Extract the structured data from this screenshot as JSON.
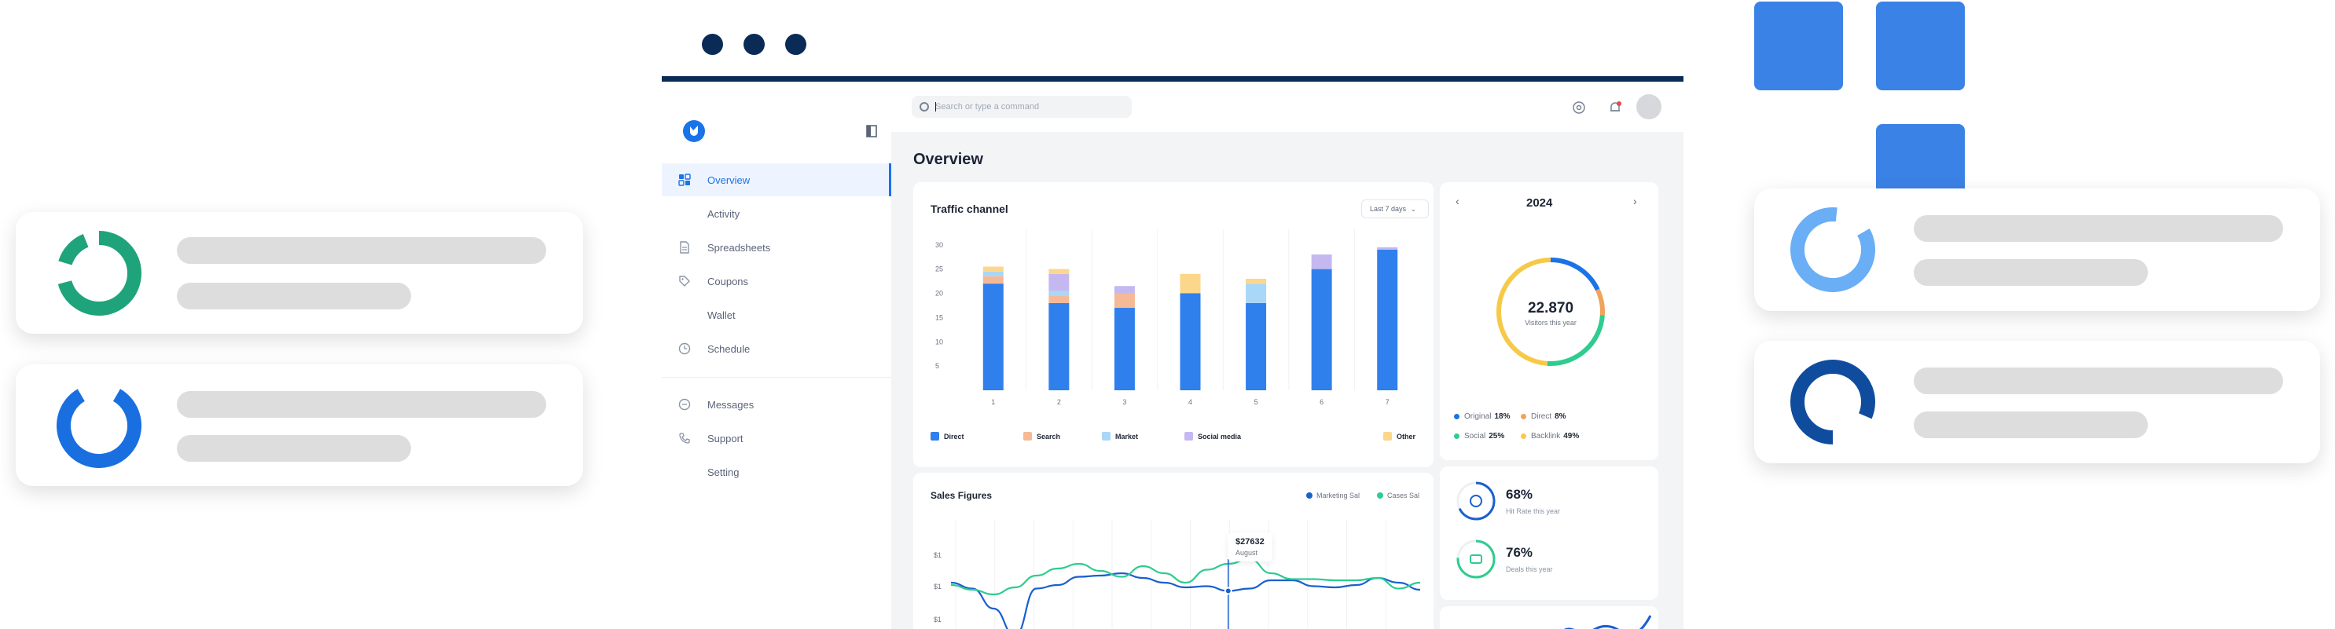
{
  "app": {
    "brand_color": "#1a73e8",
    "dark_navy": "#0b2b57"
  },
  "sidebar": {
    "items": [
      {
        "label": "Overview",
        "icon": "grid-icon",
        "active": true
      },
      {
        "label": "Activity",
        "icon": ""
      },
      {
        "label": "Spreadsheets",
        "icon": "document-icon"
      },
      {
        "label": "Coupons",
        "icon": "tag-icon"
      },
      {
        "label": "Wallet",
        "icon": ""
      },
      {
        "label": "Schedule",
        "icon": "clock-icon"
      },
      {
        "label": "Messages",
        "icon": "chat-icon"
      },
      {
        "label": "Support",
        "icon": "phone-icon"
      },
      {
        "label": "Setting",
        "icon": ""
      }
    ]
  },
  "header": {
    "search_placeholder": "Search or type a command"
  },
  "main": {
    "page_title": "Overview"
  },
  "traffic": {
    "title": "Traffic channel",
    "range_label": "Last 7 days"
  },
  "year_panel": {
    "year": "2024",
    "total": "22.870",
    "caption": "Visitors this year",
    "stats": [
      {
        "label": "Original",
        "value": "18%",
        "color": "#1a73e8"
      },
      {
        "label": "Direct",
        "value": "8%",
        "color": "#f0a35a"
      },
      {
        "label": "Social",
        "value": "25%",
        "color": "#2ecc8f"
      },
      {
        "label": "Backlink",
        "value": "49%",
        "color": "#f7c948"
      }
    ]
  },
  "sales": {
    "title": "Sales Figures",
    "legend": [
      {
        "label": "Marketing Sal",
        "color": "#1a5fd0"
      },
      {
        "label": "Cases Sal",
        "color": "#2ecc8f"
      }
    ],
    "tooltip_value": "$27632",
    "tooltip_label": "August"
  },
  "kpis": [
    {
      "value": "68%",
      "label": "Hit Rate this year",
      "color": "#1a5fd0",
      "fraction": 0.68
    },
    {
      "value": "76%",
      "label": "Deals this year",
      "color": "#2ecc8f",
      "fraction": 0.76
    }
  ],
  "chart_data": [
    {
      "type": "bar",
      "title": "Traffic channel",
      "categories": [
        "1",
        "2",
        "3",
        "4",
        "5",
        "6",
        "7"
      ],
      "yticks": [
        5,
        10,
        15,
        20,
        25,
        30
      ],
      "ylim": [
        0,
        30
      ],
      "stacked": true,
      "grid": false,
      "legend_position": "bottom",
      "series": [
        {
          "name": "Direct",
          "color": "#2f80ed",
          "values": [
            22,
            18,
            17,
            20,
            18,
            25,
            29
          ]
        },
        {
          "name": "Search",
          "color": "#f6b995",
          "values": [
            1.5,
            1.5,
            3,
            0,
            0,
            0,
            0
          ]
        },
        {
          "name": "Market",
          "color": "#a9d7f7",
          "values": [
            1,
            1,
            0,
            0,
            4,
            0,
            0
          ]
        },
        {
          "name": "Social media",
          "color": "#c5b8f1",
          "values": [
            0,
            3.5,
            1.5,
            0,
            0,
            3,
            0.5
          ]
        },
        {
          "name": "Other",
          "color": "#fcd68a",
          "values": [
            1,
            1,
            0,
            4,
            1,
            0,
            0
          ]
        }
      ]
    },
    {
      "type": "line",
      "title": "Sales Figures",
      "yticks": [
        "",
        "$1",
        "$1",
        "$1"
      ],
      "grid": true,
      "legend_position": "top-right",
      "series": [
        {
          "name": "Marketing Sal",
          "color": "#1a5fd0",
          "values": [
            40,
            45,
            62,
            85,
            45,
            42,
            35,
            34,
            32,
            36,
            40,
            44,
            43,
            47,
            45,
            38,
            38,
            43,
            44,
            42,
            36,
            40,
            46
          ]
        },
        {
          "name": "Cases Sal",
          "color": "#2ecc8f",
          "values": [
            42,
            46,
            50,
            44,
            34,
            28,
            24,
            30,
            35,
            26,
            32,
            40,
            29,
            24,
            20,
            32,
            37,
            37,
            38,
            38,
            36,
            45,
            40
          ]
        }
      ]
    }
  ]
}
